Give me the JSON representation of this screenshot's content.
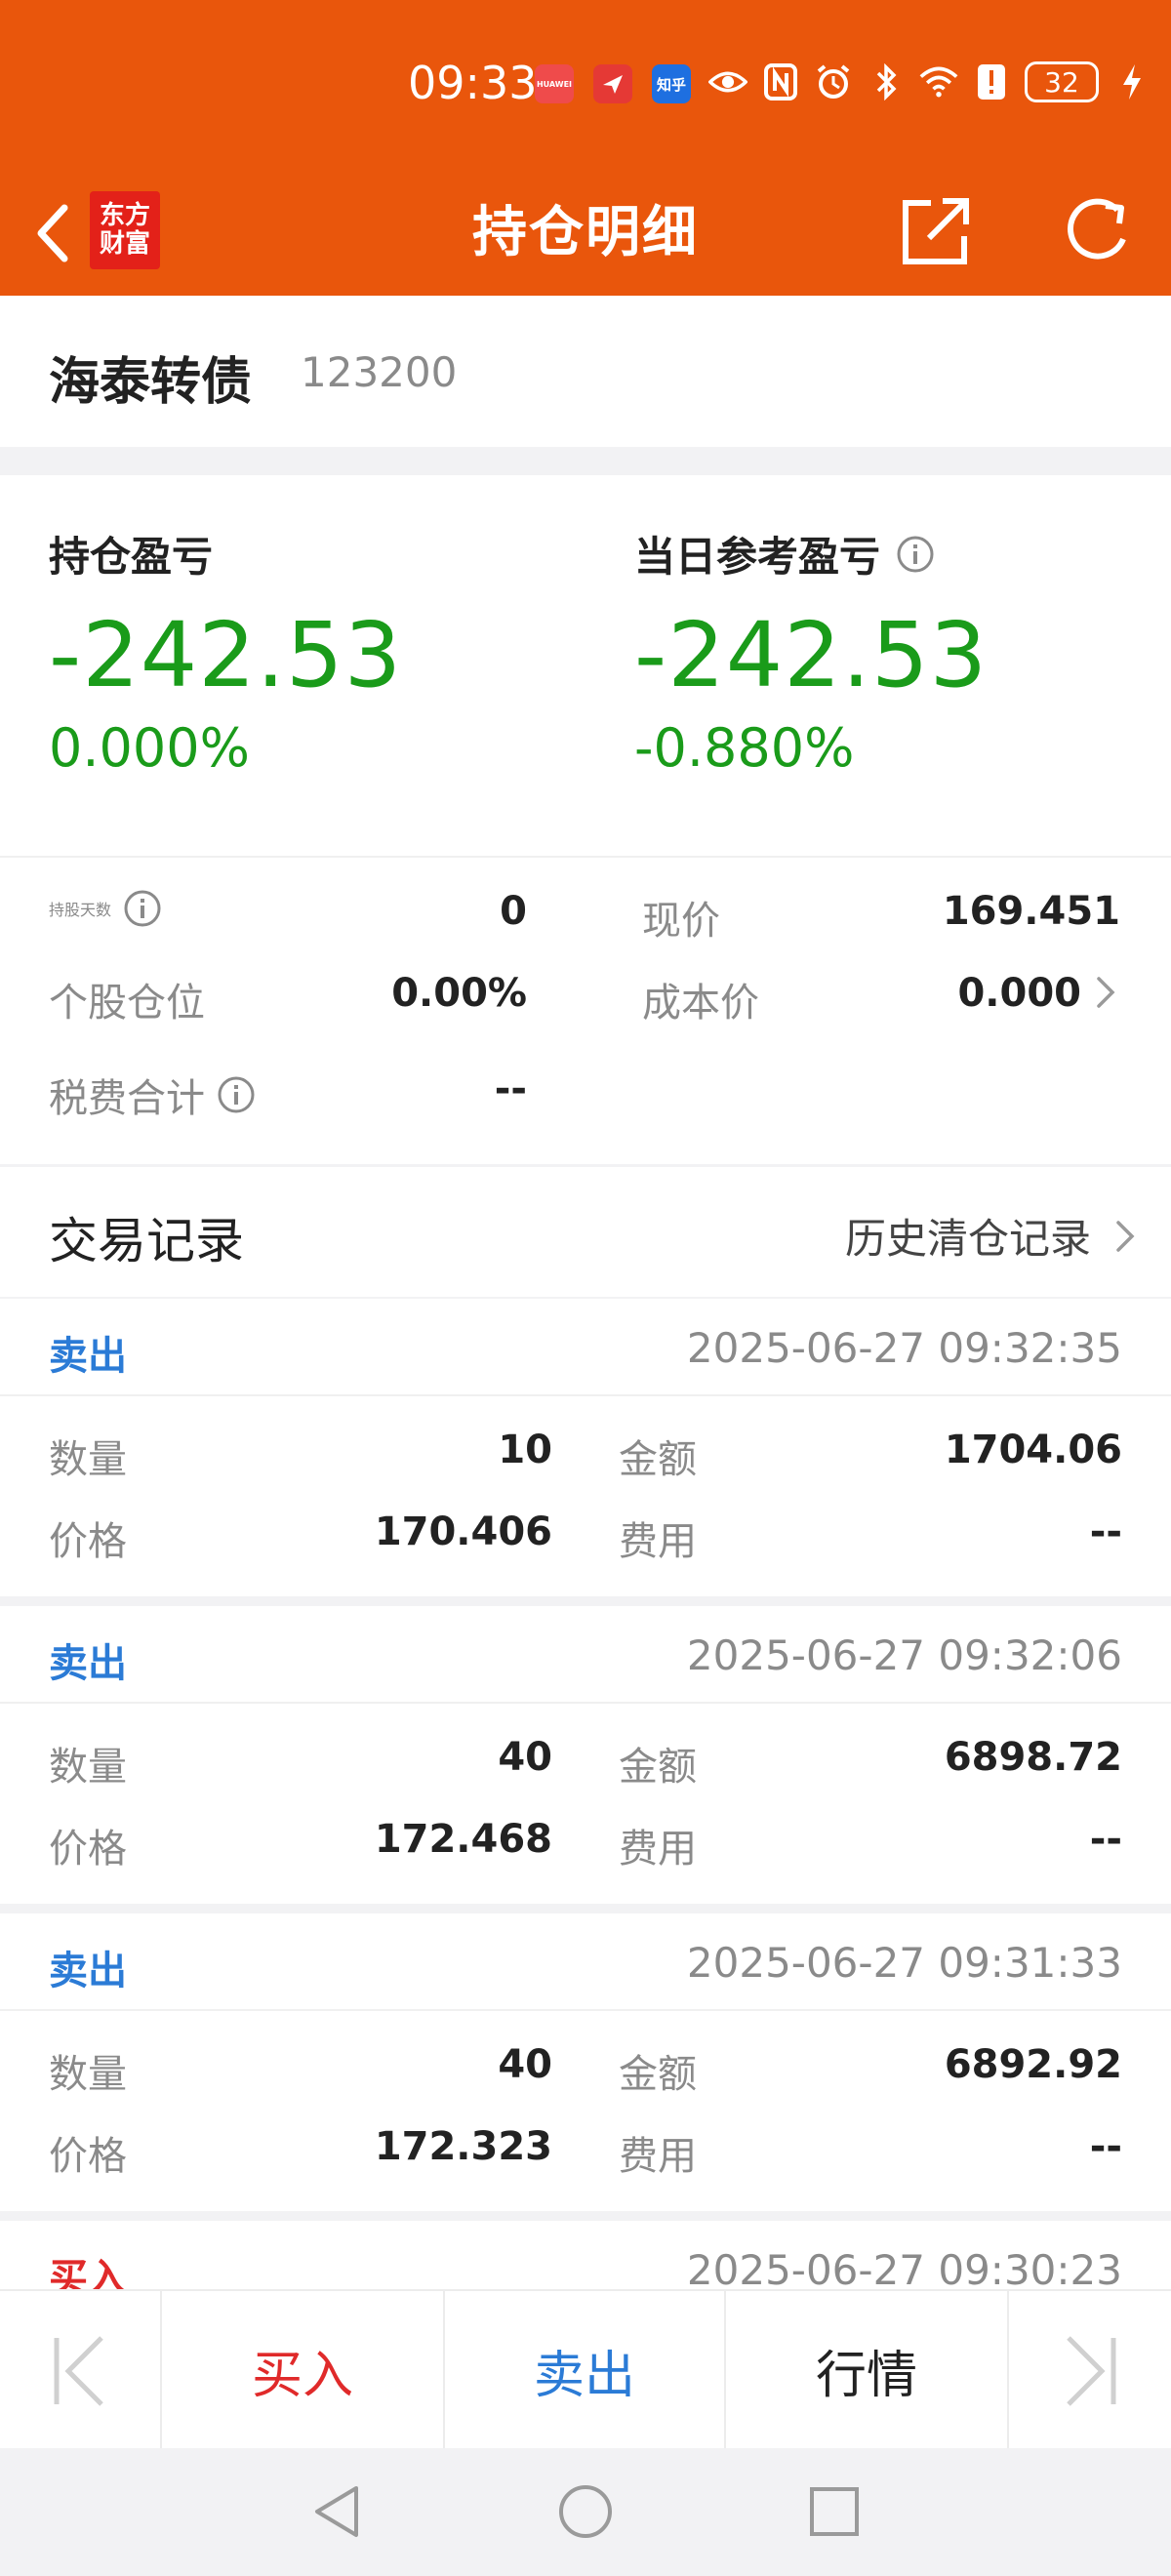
{
  "status_bar": {
    "time": "09:33",
    "battery": "32",
    "apps": [
      {
        "icon": "huawei-app-icon",
        "text": "HUAWEI",
        "color": "#ef4b4b"
      },
      {
        "icon": "send-app-icon",
        "text": "",
        "color": "#e53935"
      },
      {
        "icon": "zhihu-app-icon",
        "text": "知乎",
        "color": "#1e6fe0"
      }
    ],
    "indicators": [
      "eye-icon",
      "nfc-icon",
      "alarm-icon",
      "bluetooth-icon",
      "wifi-icon",
      "alert-icon",
      "battery-icon",
      "charging-icon"
    ]
  },
  "header": {
    "brand": [
      "东方",
      "财富"
    ],
    "title": "持仓明细",
    "back_icon": "chevron-left-icon",
    "share_icon": "share-icon",
    "refresh_icon": "refresh-icon",
    "background_color": "#e9560c"
  },
  "stock": {
    "name": "海泰转债",
    "code": "123200"
  },
  "pnl": {
    "position": {
      "label": "持仓盈亏",
      "value": "-242.53",
      "percent": "0.000%"
    },
    "daily": {
      "label": "当日参考盈亏",
      "value": "-242.53",
      "percent": "-0.880%"
    },
    "loss_color": "#1a9b1a"
  },
  "details": {
    "hold_days": {
      "label": "持股天数",
      "value": "0"
    },
    "position_ratio": {
      "label": "个股仓位",
      "value": "0.00%"
    },
    "fees_total": {
      "label": "税费合计",
      "value": "--"
    },
    "current_price": {
      "label": "现价",
      "value": "169.451"
    },
    "cost_price": {
      "label": "成本价",
      "value": "0.000"
    }
  },
  "records": {
    "title": "交易记录",
    "history_link": "历史清仓记录",
    "labels": {
      "quantity": "数量",
      "price": "价格",
      "amount": "金额",
      "fee": "费用"
    },
    "trades": [
      {
        "side": "卖出",
        "type": "sell",
        "time": "2025-06-27 09:32:35",
        "quantity": "10",
        "price": "170.406",
        "amount": "1704.06",
        "fee": "--"
      },
      {
        "side": "卖出",
        "type": "sell",
        "time": "2025-06-27 09:32:06",
        "quantity": "40",
        "price": "172.468",
        "amount": "6898.72",
        "fee": "--"
      },
      {
        "side": "卖出",
        "type": "sell",
        "time": "2025-06-27 09:31:33",
        "quantity": "40",
        "price": "172.323",
        "amount": "6892.92",
        "fee": "--"
      },
      {
        "side": "买入",
        "type": "buy",
        "time": "2025-06-27 09:30:23"
      }
    ],
    "sell_color": "#2b7bd6",
    "buy_color": "#e02a2a"
  },
  "toolbar": {
    "first_icon": "skip-first-icon",
    "buy": "买入",
    "sell": "卖出",
    "quote": "行情",
    "last_icon": "skip-last-icon"
  },
  "system_nav": [
    "nav-back-icon",
    "nav-home-icon",
    "nav-recents-icon"
  ]
}
